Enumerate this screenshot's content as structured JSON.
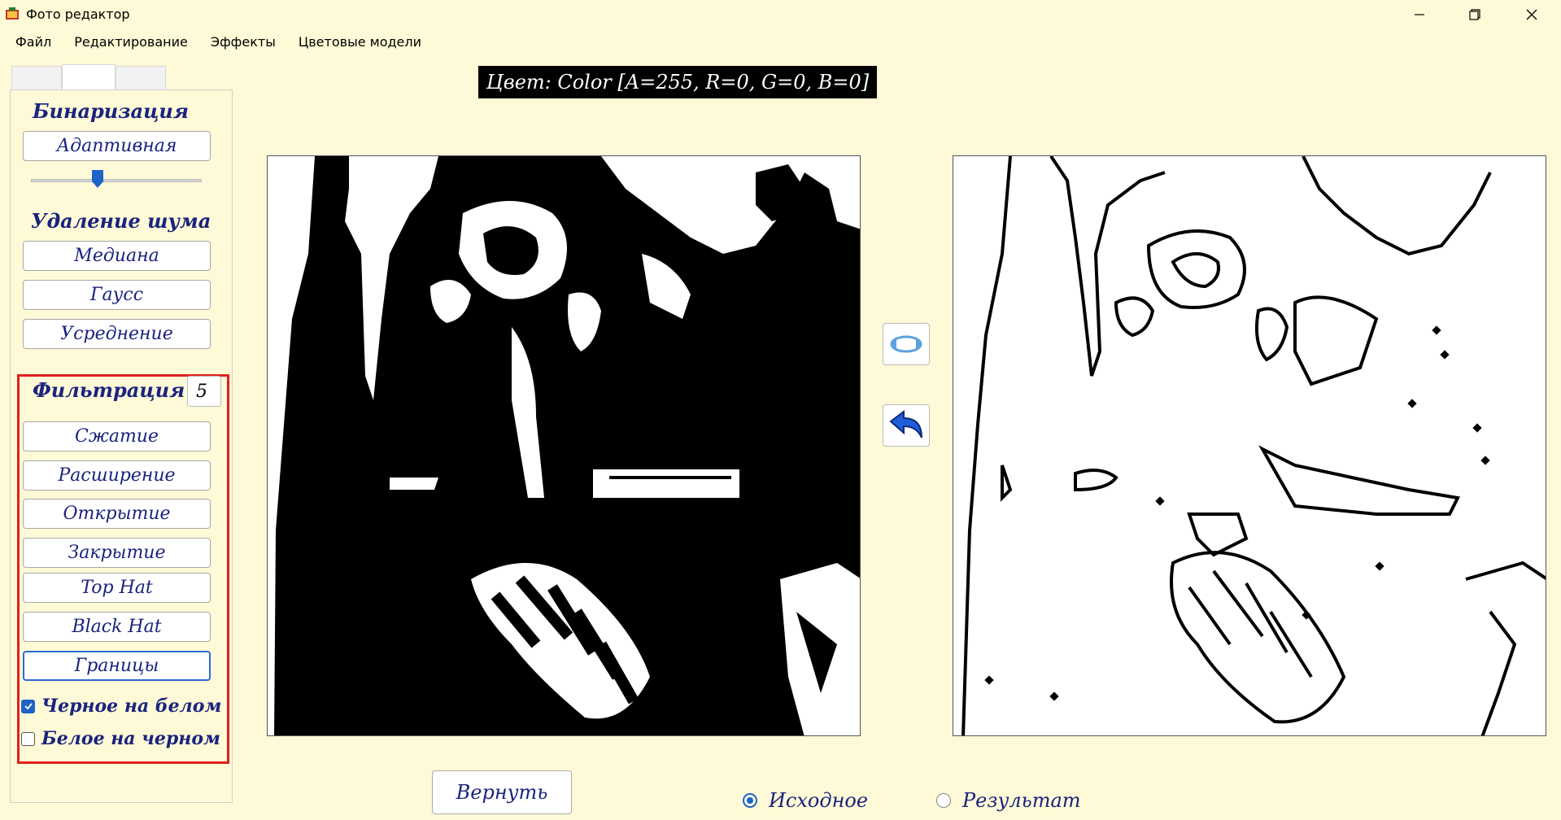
{
  "window": {
    "title": "Фото редактор"
  },
  "menu": [
    "Файл",
    "Редактирование",
    "Эффекты",
    "Цветовые модели"
  ],
  "color_label": "Цвет: Color [A=255, R=0, G=0, B=0]",
  "panel": {
    "binarization": {
      "label": "Бинаризация",
      "button": "Адаптивная",
      "slider_value_fraction": 0.35
    },
    "noise": {
      "label": "Удаление шума",
      "buttons": [
        "Медиана",
        "Гаусс",
        "Усреднение"
      ]
    },
    "filtering": {
      "label": "Фильтрация",
      "kernel_size": "5",
      "buttons": [
        "Сжатие",
        "Расширение",
        "Открытие",
        "Закрытие",
        "Top Hat",
        "Black Hat",
        "Границы"
      ],
      "options": [
        {
          "label": "Черное на белом",
          "checked": true
        },
        {
          "label": "Белое на черном",
          "checked": false
        }
      ]
    }
  },
  "bottom": {
    "return_button": "Вернуть",
    "radios": [
      {
        "label": "Исходное",
        "selected": true
      },
      {
        "label": "Результат",
        "selected": false
      }
    ]
  },
  "colors": {
    "background": "#fef9d6",
    "accent_text": "#1a237e",
    "highlight_border": "#e0201b",
    "focus_blue": "#1e63c6"
  },
  "icons": [
    "app-icon",
    "minimize-icon",
    "restore-icon",
    "close-icon",
    "rotate-icon",
    "back-arrow-icon"
  ]
}
